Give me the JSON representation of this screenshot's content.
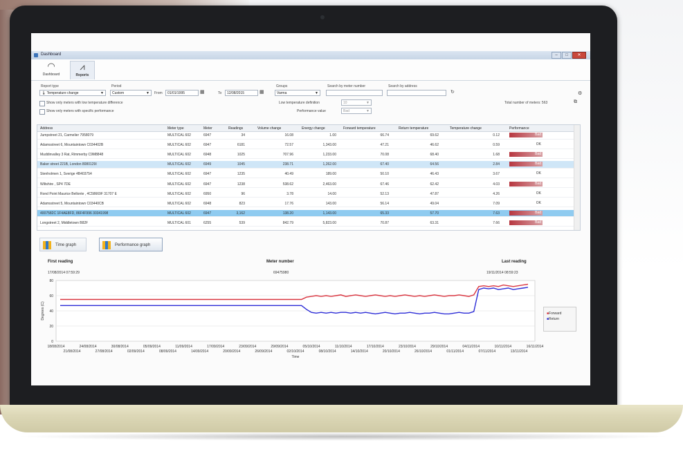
{
  "window": {
    "title": "Dashboard"
  },
  "ribbon": {
    "tabs": [
      {
        "label": "Dashboard",
        "icon": "gauge-icon"
      },
      {
        "label": "Reports",
        "icon": "chart-icon"
      }
    ]
  },
  "filters": {
    "report_type_label": "Report type",
    "report_type_value": "Temperature change",
    "period_label": "Period",
    "period_value": "Custom",
    "from_label": "From",
    "from_value": "01/01/1995",
    "to_label": "To",
    "to_value": "12/08/2015",
    "groups_label": "Groups",
    "groups_value": "Varma",
    "search_meter_label": "Search by meter number",
    "search_address_label": "Search by address",
    "low_temp_check": "Show only meters with low temperature difference",
    "specific_perf_check": "Show only meters with specific performance",
    "low_temp_def_label": "Low temperature definition",
    "low_temp_def_value": "10",
    "perf_value_label": "Performance value",
    "perf_value_value": "Bad",
    "total_meters": "Total number of meters: 563"
  },
  "table": {
    "headers": [
      "Address",
      "Meter type",
      "Meter",
      "Readings",
      "Volume change",
      "Energy change",
      "Forward temperature",
      "Return temperature",
      "Temperature change",
      "Performance"
    ],
    "rows": [
      {
        "address": "Jumpstreet 21, Carmelier 7958079",
        "type": "MULTICAL 602",
        "meter": "6947",
        "readings": "34",
        "volume": "16.08",
        "energy": "1.00",
        "fwd": "66.74",
        "ret": "69.62",
        "tchg": "0.12",
        "perf": "Bad",
        "bad": true
      },
      {
        "address": "Adamsstreet 6, Mountaintown C034402B",
        "type": "MULTICAL 602",
        "meter": "6947",
        "readings": "6181",
        "volume": "72.57",
        "energy": "1,343.00",
        "fwd": "47.21",
        "ret": "46.62",
        "tchg": "0.59",
        "perf": "OK",
        "bad": false
      },
      {
        "address": "Muddinvalley 3 Rat, Rimmerby C9M8848",
        "type": "MULTICAL 602",
        "meter": "6948",
        "readings": "1025",
        "volume": "707.96",
        "energy": "1,233.00",
        "fwd": "70.08",
        "ret": "68.40",
        "tchg": "1.68",
        "perf": "Bad",
        "bad": true
      },
      {
        "address": "Baker street 221B, London 8080129I",
        "type": "MULTICAL 602",
        "meter": "6949",
        "readings": "1045",
        "volume": "238.71",
        "energy": "1,262.00",
        "fwd": "67.40",
        "ret": "64.56",
        "tchg": "2.84",
        "perf": "Bad",
        "bad": true,
        "sel": 1
      },
      {
        "address": "Stenholmen 1, Sverige 4B403754",
        "type": "MULTICAL 602",
        "meter": "6947",
        "readings": "1235",
        "volume": "40.49",
        "energy": "189.00",
        "fwd": "50.10",
        "ret": "46.43",
        "tchg": "3.67",
        "perf": "OK",
        "bad": false
      },
      {
        "address": "Wiltshire , SP4 7DE",
        "type": "MULTICAL 602",
        "meter": "6947",
        "readings": "1238",
        "volume": "538.62",
        "energy": "2,463.00",
        "fwd": "67.46",
        "ret": "62.42",
        "tchg": "4.03",
        "perf": "Bad",
        "bad": true
      },
      {
        "address": "Rond Point Maurice Bellonte , 4C58669F 31707 E",
        "type": "MULTICAL 602",
        "meter": "6950",
        "readings": "96",
        "volume": "3.78",
        "energy": "14.00",
        "fwd": "52.13",
        "ret": "47.87",
        "tchg": "4.26",
        "perf": "OK",
        "bad": false
      },
      {
        "address": "Adamsstreet 5, Mountaintown C03440CB",
        "type": "MULTICAL 602",
        "meter": "6948",
        "readings": "823",
        "volume": "17.76",
        "energy": "143.00",
        "fwd": "56.14",
        "ret": "49.04",
        "tchg": "7.09",
        "perf": "OK",
        "bad": false
      },
      {
        "address": "4007582C 1F4AE8FD, 86F4F996 30341998",
        "type": "MULTICAL 602",
        "meter": "6947",
        "readings": "3,162",
        "volume": "138.20",
        "energy": "1,143.00",
        "fwd": "65.33",
        "ret": "57.70",
        "tchg": "7.63",
        "perf": "Bad",
        "bad": true,
        "sel": 2
      },
      {
        "address": "Longstreet 2, Middletown B82F",
        "type": "MULTICAL 601",
        "meter": "6255",
        "readings": "539",
        "volume": "842.79",
        "energy": "5,823.00",
        "fwd": "70.87",
        "ret": "63.31",
        "tchg": "7.66",
        "perf": "Bad",
        "bad": true
      }
    ]
  },
  "graph_buttons": {
    "time": "Time graph",
    "performance": "Performance graph"
  },
  "info": {
    "first_reading_label": "First reading",
    "first_reading_value": "17/08/2014 07:59:29",
    "meter_number_label": "Meter number",
    "meter_number_value": "69475980",
    "last_reading_label": "Last reading",
    "last_reading_value": "19/11/2014 08:59:23"
  },
  "chart_data": {
    "type": "line",
    "xlabel": "Time",
    "ylabel": "Degrees (C)",
    "ylim": [
      0,
      80
    ],
    "yticks": [
      0,
      20,
      40,
      60,
      80
    ],
    "xticks_top": [
      "18/08/2014",
      "24/08/2014",
      "30/08/2014",
      "05/09/2014",
      "11/09/2014",
      "17/09/2014",
      "23/09/2014",
      "29/09/2014",
      "05/10/2014",
      "11/10/2014",
      "17/10/2014",
      "23/10/2014",
      "29/10/2014",
      "04/11/2014",
      "10/11/2014",
      "16/11/2014"
    ],
    "xticks_bottom": [
      "21/08/2014",
      "27/08/2014",
      "02/09/2014",
      "08/09/2014",
      "14/09/2014",
      "20/09/2014",
      "26/09/2014",
      "02/10/2014",
      "08/10/2014",
      "14/10/2014",
      "20/10/2014",
      "26/10/2014",
      "01/11/2014",
      "07/11/2014",
      "13/11/2014"
    ],
    "series": [
      {
        "name": "Forward",
        "color": "#d9343f",
        "values": [
          55,
          55,
          55,
          55,
          55,
          55,
          55,
          55,
          55,
          55,
          55,
          55,
          55,
          55,
          55,
          55,
          55,
          55,
          55,
          55,
          55,
          55,
          55,
          55,
          55,
          55,
          55,
          55,
          55,
          55,
          55,
          55,
          55,
          55,
          55,
          55,
          55,
          55,
          55,
          55,
          55,
          55,
          55,
          55,
          55,
          55,
          55,
          55,
          55,
          55,
          58,
          59,
          60,
          59,
          60,
          59,
          60,
          61,
          59,
          60,
          61,
          60,
          59,
          60,
          61,
          60,
          59,
          60,
          59,
          60,
          61,
          60,
          59,
          60,
          59,
          60,
          61,
          60,
          59,
          60,
          60,
          61,
          60,
          59,
          61,
          72,
          73,
          72,
          73,
          72,
          74,
          73,
          72,
          73,
          74,
          75
        ]
      },
      {
        "name": "Return",
        "color": "#2b2bd6",
        "values": [
          47,
          47,
          47,
          47,
          47,
          47,
          47,
          47,
          47,
          47,
          47,
          47,
          47,
          47,
          47,
          47,
          47,
          47,
          47,
          47,
          47,
          47,
          47,
          47,
          47,
          47,
          47,
          47,
          47,
          47,
          47,
          47,
          47,
          47,
          47,
          47,
          47,
          47,
          47,
          47,
          47,
          47,
          47,
          47,
          47,
          47,
          47,
          47,
          47,
          47,
          42,
          38,
          37,
          38,
          37,
          38,
          37,
          38,
          38,
          37,
          38,
          37,
          38,
          37,
          36,
          37,
          38,
          37,
          36,
          37,
          37,
          38,
          37,
          36,
          37,
          37,
          38,
          37,
          36,
          36,
          37,
          38,
          37,
          37,
          39,
          68,
          70,
          69,
          70,
          68,
          69,
          70,
          68,
          69,
          70,
          71
        ]
      }
    ],
    "legend": "right"
  }
}
